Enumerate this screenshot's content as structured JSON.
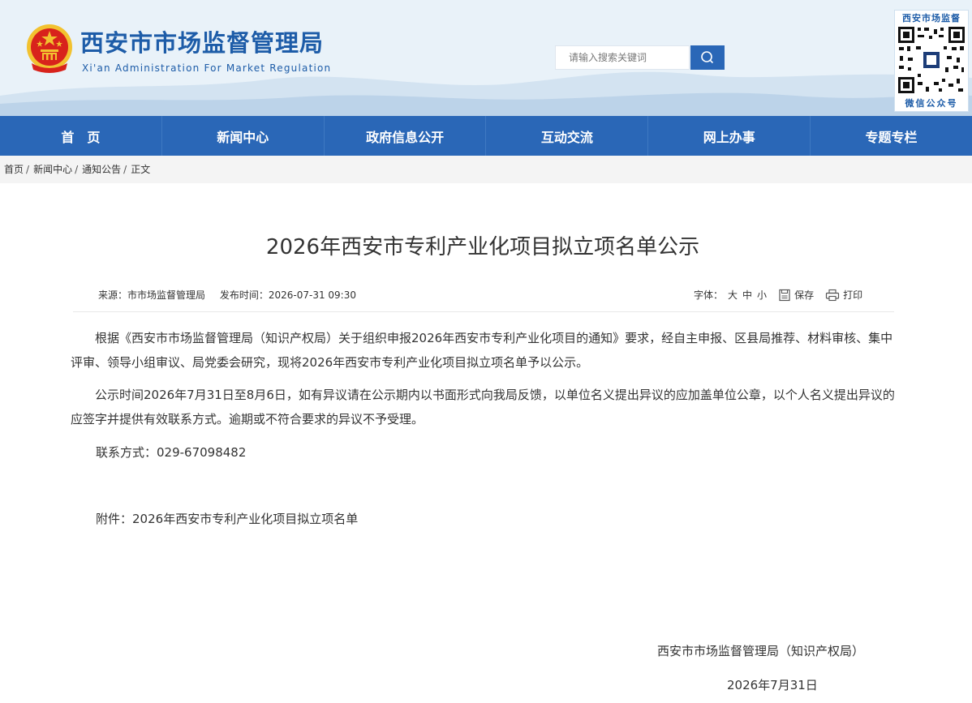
{
  "header": {
    "title": "西安市市场监督管理局",
    "subtitle": "Xi'an Administration For Market Regulation",
    "search_placeholder": "请输入搜索关键词",
    "qr_top": "西安市场监督",
    "qr_bottom": "微信公众号"
  },
  "nav": {
    "items": [
      "首　页",
      "新闻中心",
      "政府信息公开",
      "互动交流",
      "网上办事",
      "专题专栏"
    ]
  },
  "breadcrumb": {
    "home": "首页",
    "news": "新闻中心",
    "notice": "通知公告",
    "current": "正文",
    "separator": "/"
  },
  "article": {
    "title": "2026年西安市专利产业化项目拟立项名单公示",
    "source": "来源：市市场监督管理局",
    "publish_time": "发布时间：2026-07-31 09:30",
    "font_label": "字体：",
    "size_large": "大",
    "size_medium": "中",
    "size_small": "小",
    "save": "保存",
    "print": "打印",
    "para1": "根据《西安市市场监督管理局（知识产权局）关于组织申报2026年西安市专利产业化项目的通知》要求，经自主申报、区县局推荐、材料审核、集中评审、领导小组审议、局党委会研究，现将2026年西安市专利产业化项目拟立项名单予以公示。",
    "para2": "公示时间2026年7月31日至8月6日，如有异议请在公示期内以书面形式向我局反馈，以单位名义提出异议的应加盖单位公章，以个人名义提出异议的应签字并提供有效联系方式。逾期或不符合要求的异议不予受理。",
    "contact": "联系方式：029-67098482",
    "attach_label": "附件：",
    "attach_link": "2026年西安市专利产业化项目拟立项名单",
    "signature": "西安市市场监督管理局（知识产权局）",
    "date": "2026年7月31日"
  },
  "colors": {
    "brand_blue": "#2a67b7",
    "title_blue": "#1d5ca8",
    "emblem_red": "#d8231c",
    "emblem_gold": "#f2c230"
  }
}
